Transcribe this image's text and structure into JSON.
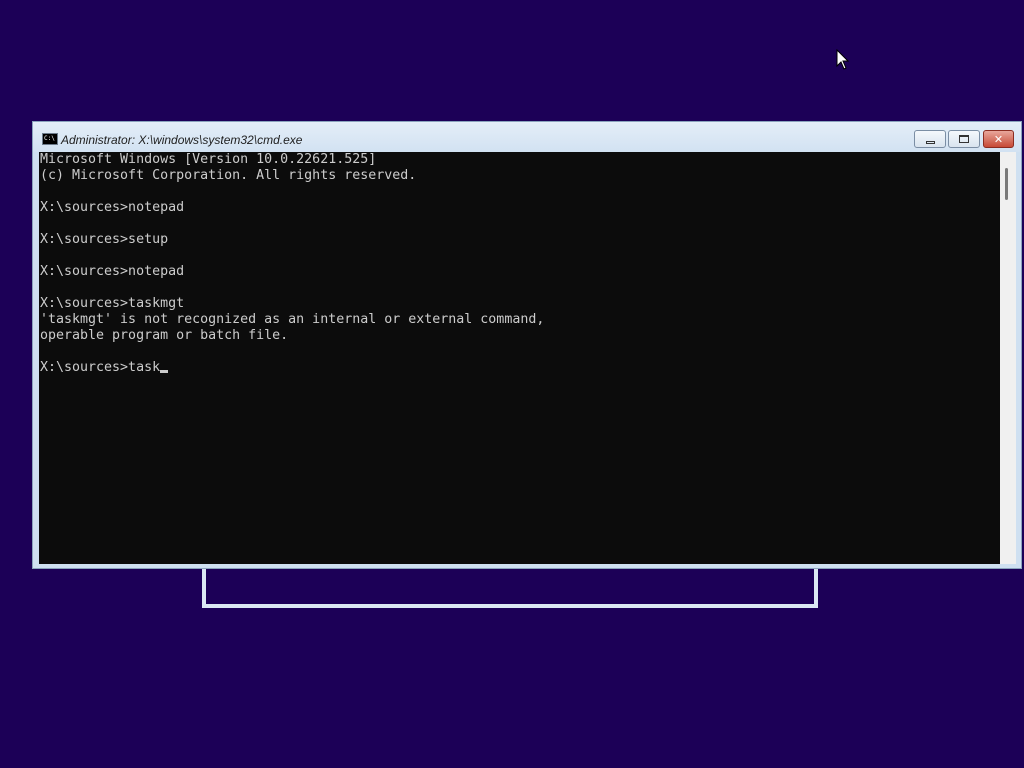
{
  "window": {
    "title": "Administrator: X:\\windows\\system32\\cmd.exe",
    "minimize_icon": "minimize-icon",
    "maximize_icon": "maximize-icon",
    "close_icon": "close-icon"
  },
  "console": {
    "lines": [
      "Microsoft Windows [Version 10.0.22621.525]",
      "(c) Microsoft Corporation. All rights reserved.",
      "",
      "X:\\sources>notepad",
      "",
      "X:\\sources>setup",
      "",
      "X:\\sources>notepad",
      "",
      "X:\\sources>taskmgt",
      "'taskmgt' is not recognized as an internal or external command,",
      "operable program or batch file.",
      "",
      "X:\\sources>task"
    ]
  },
  "colors": {
    "desktop_background": "#1c0057",
    "console_background": "#0c0c0c",
    "console_text": "#cccccc"
  }
}
